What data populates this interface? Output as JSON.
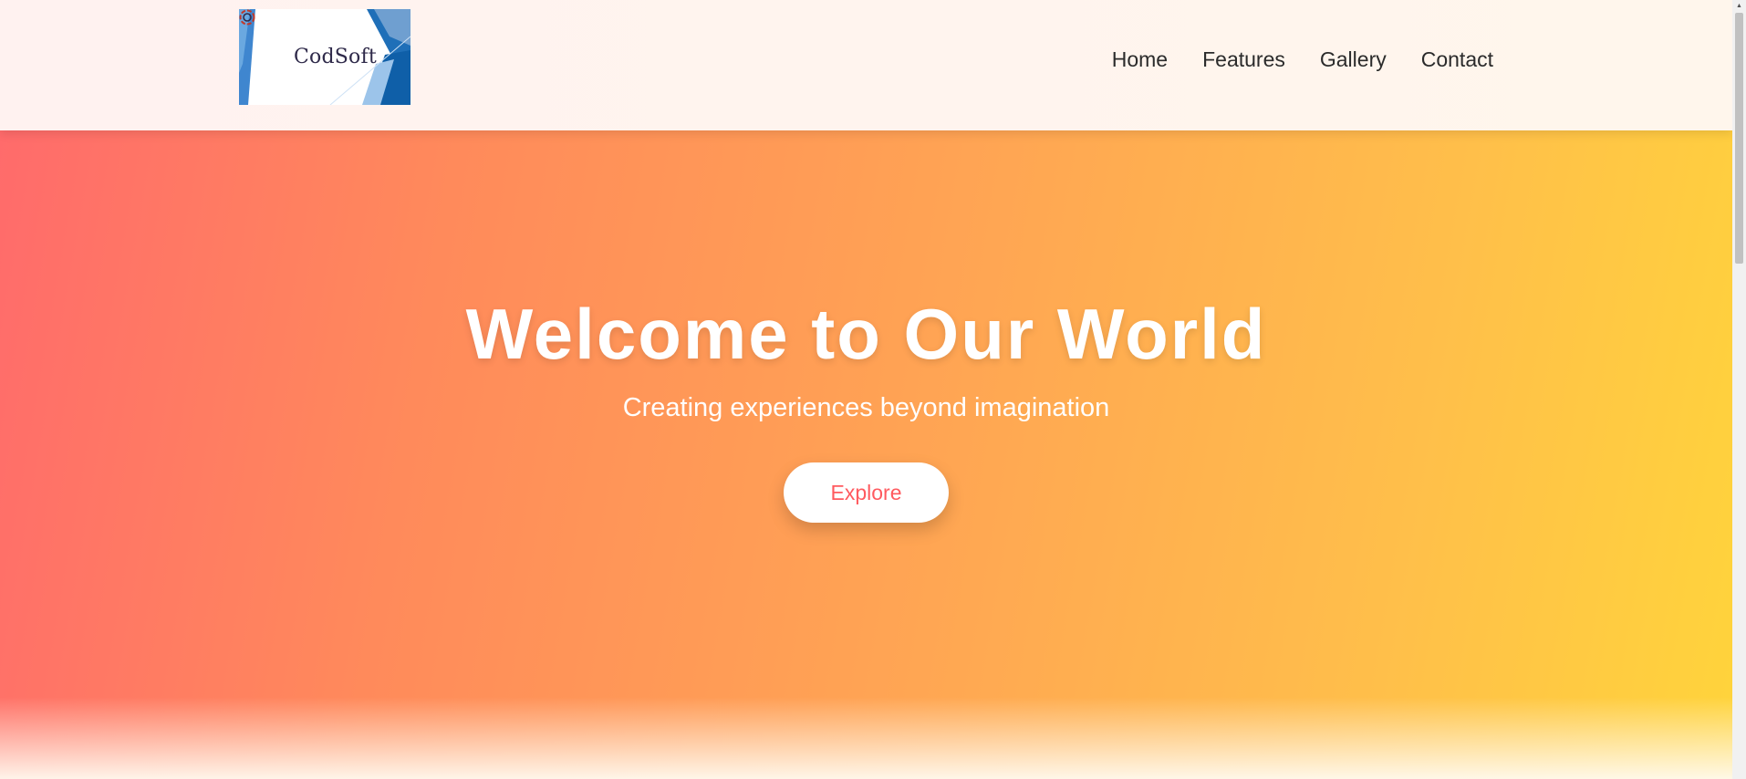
{
  "header": {
    "logo_text": "CodSoft",
    "nav": [
      "Home",
      "Features",
      "Gallery",
      "Contact"
    ]
  },
  "hero": {
    "title": "Welcome to Our World",
    "subtitle": "Creating experiences beyond imagination",
    "button_label": "Explore"
  },
  "icons": {
    "logo": "codsoft-logo",
    "scroll_up": "chevron-up-icon"
  },
  "colors": {
    "hero_gradient_start": "#ff6b6b",
    "hero_gradient_end": "#ffd43b",
    "button_text": "#ff5a5f",
    "nav_text": "#2b2b2b"
  }
}
